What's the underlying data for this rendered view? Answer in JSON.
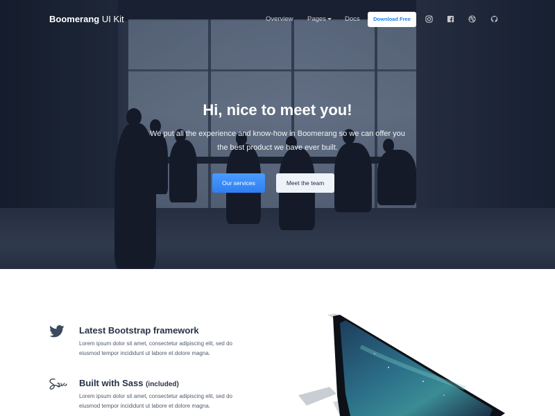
{
  "brand": {
    "name_bold": "Boomerang",
    "name_light": " UI Kit"
  },
  "nav": {
    "links": [
      "Overview",
      "Pages",
      "Docs"
    ],
    "download_label": "Download Free",
    "icons": [
      "instagram-icon",
      "facebook-icon",
      "dribbble-icon",
      "github-icon"
    ]
  },
  "hero": {
    "title": "Hi, nice to meet you!",
    "lead": "We put all the experience and know-how in Boomerang so we can offer you the best product we have ever built.",
    "primary_button": "Our services",
    "secondary_button": "Meet the team"
  },
  "features": [
    {
      "icon": "twitter-icon",
      "title": "Latest Bootstrap framework",
      "text": "Lorem ipsum dolor sit amet, consectetur adipiscing elit, sed do eiusmod tempor incididunt ut labore et dolore magna."
    },
    {
      "icon": "sass-icon",
      "title": "Built with Sass",
      "title_note": "(included)",
      "text": "Lorem ipsum dolor sit amet, consectetur adipiscing elit, sed do eiusmod tempor incididunt ut labore et dolore magna."
    }
  ],
  "colors": {
    "accent": "#2f7ff2",
    "hero_dark": "#172031",
    "text": "#263245"
  }
}
